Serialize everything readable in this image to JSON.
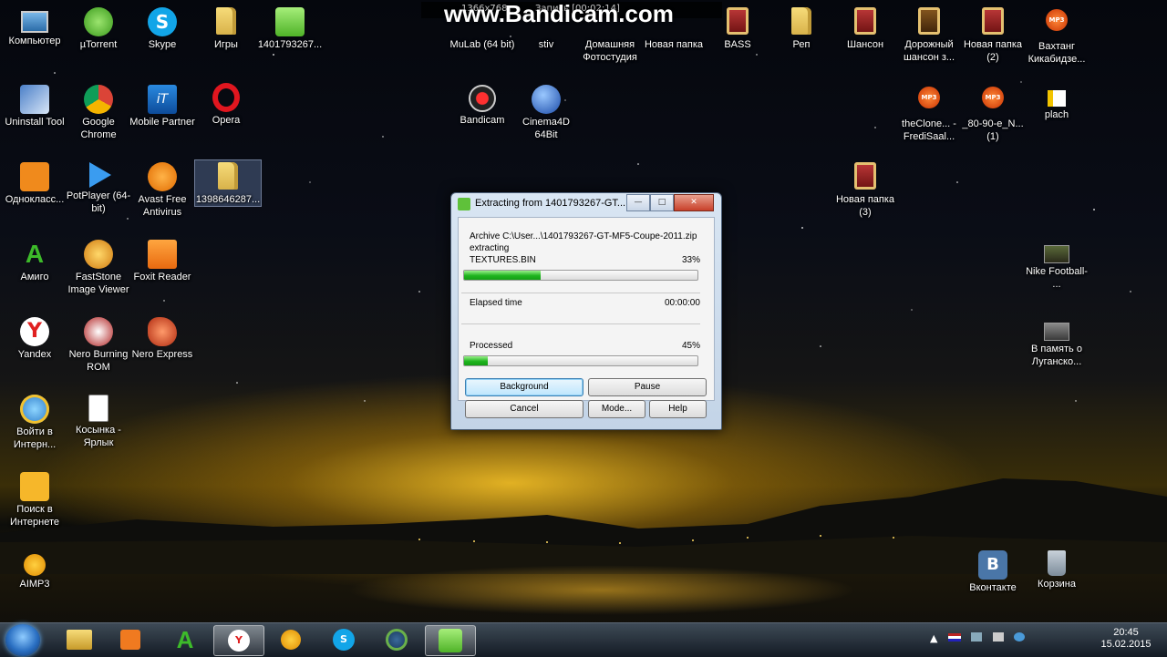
{
  "recorder": {
    "brand": "www.Bandicam.com",
    "resolution": "1366x768",
    "status": "Запись [00:02:14]"
  },
  "desktop": {
    "col1": [
      "Компьютер",
      "Uninstall Tool",
      "Однокласс...",
      "Амиго",
      "Yandex",
      "Войти в Интерн...",
      "Поиск в Интернете",
      "AIMP3"
    ],
    "col2": [
      "µTorrent",
      "Google Chrome",
      "PotPlayer (64-bit)",
      "FastStone Image Viewer",
      "Nero Burning ROM",
      "Косынка - Ярлык"
    ],
    "col3": [
      "Skype",
      "Mobile Partner",
      "Avast Free Antivirus",
      "Foxit Reader",
      "Nero Express"
    ],
    "col4": [
      "Игры",
      "Opera",
      "1398646287..."
    ],
    "col5": [
      "1401793267..."
    ],
    "top_row": [
      "MuLab (64 bit)",
      "stiv",
      "Домашняя Фотостудия",
      "Новая папка",
      "BASS",
      "Реп",
      "Шансон",
      "Дорожный шансон з...",
      "Новая папка (2)",
      "Вахтанг Кикабидзе..."
    ],
    "row2": [
      "Bandicam",
      "Cinema4D 64Bit",
      "theClone... - FrediSaal...",
      "_80-90-e_N... (1)",
      "plach"
    ],
    "misc": [
      "Новая папка (3)",
      "Nike Football- ...",
      "В память о Луганско...",
      "Вконтакте",
      "Корзина"
    ]
  },
  "dialog": {
    "title": "Extracting from 1401793267-GT...",
    "archive_line": "Archive C:\\User...\\1401793267-GT-MF5-Coupe-2011.zip",
    "action": "extracting",
    "file": "TEXTURES.BIN",
    "file_percent": "33%",
    "file_progress": 0.33,
    "elapsed_label": "Elapsed time",
    "elapsed_value": "00:00:00",
    "processed_label": "Processed",
    "processed_percent": "45%",
    "processed_progress": 0.1,
    "buttons": {
      "background": "Background",
      "pause": "Pause",
      "cancel": "Cancel",
      "mode": "Mode...",
      "help": "Help"
    },
    "window_buttons": {
      "minimize": "—",
      "maximize": "□",
      "close": "✕"
    }
  },
  "taskbar": {
    "items": [
      "Проводник",
      "Media Player",
      "Амиго",
      "Yandex",
      "AIMP3",
      "Skype",
      "Avast",
      "WinRAR"
    ],
    "clock_time": "20:45",
    "clock_date": "15.02.2015",
    "tray_arrow": "▲"
  },
  "colors": {
    "progress_green": "#1fb41f",
    "dialog_bg": "#c3d4e7",
    "close_red": "#c8402a"
  }
}
